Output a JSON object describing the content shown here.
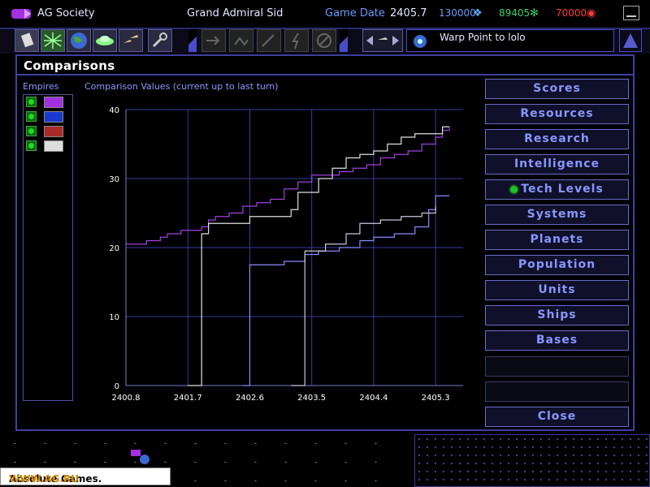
{
  "topbar": {
    "empire_name": "AG Society",
    "player": "Grand Admiral Sid",
    "game_date_label": "Game Date",
    "game_date": "2405.7",
    "resource_minerals": "130000",
    "resource_organics": "89405",
    "resource_radioactives": "70000"
  },
  "message": {
    "text": "Warp Point to lolo"
  },
  "window": {
    "title": "Comparisons",
    "empires_label": "Empires",
    "values_label": "Comparison Values (current up to last turn)"
  },
  "side_buttons": [
    {
      "label": "Scores"
    },
    {
      "label": "Resources"
    },
    {
      "label": "Research"
    },
    {
      "label": "Intelligence"
    },
    {
      "label": "Tech Levels"
    },
    {
      "label": "Systems"
    },
    {
      "label": "Planets"
    },
    {
      "label": "Population"
    },
    {
      "label": "Units"
    },
    {
      "label": "Ships"
    },
    {
      "label": "Bases"
    }
  ],
  "close_label": "Close",
  "watermark": {
    "text1": "Absolute Games.",
    "text2": "WWW.AG.RU"
  },
  "colors": {
    "accent": "#4040a0",
    "series_purple": "#a040e0",
    "series_white": "#e0e0e0",
    "series_blue": "#8a8aff",
    "series_gray": "#c8c8dc"
  },
  "chart_data": {
    "type": "line",
    "title": "",
    "xlabel": "",
    "ylabel": "",
    "xlim": [
      2400.8,
      2405.7
    ],
    "ylim": [
      0,
      40
    ],
    "x_ticks": [
      "2400.8",
      "2401.7",
      "2402.6",
      "2403.5",
      "2404.4",
      "2405.3"
    ],
    "y_ticks": [
      "0",
      "10",
      "20",
      "30",
      "40"
    ],
    "grid": true,
    "series": [
      {
        "color": "#a040e0",
        "x": [
          2400.8,
          2401.0,
          2401.1,
          2401.3,
          2401.4,
          2401.6,
          2401.9,
          2402.0,
          2402.1,
          2402.3,
          2402.5,
          2402.7,
          2402.9,
          2403.1,
          2403.3,
          2403.5,
          2403.7,
          2403.9,
          2404.1,
          2404.3,
          2404.5,
          2404.7,
          2404.9,
          2405.1,
          2405.3,
          2405.4,
          2405.5
        ],
        "y": [
          20.5,
          20.5,
          21.0,
          21.5,
          22.0,
          22.5,
          23.0,
          24.0,
          24.5,
          25.0,
          26.0,
          26.5,
          27.0,
          28.5,
          29.5,
          30.5,
          30.5,
          31.0,
          31.5,
          32.0,
          33.0,
          33.5,
          34.0,
          35.0,
          36.0,
          37.0,
          37.5
        ]
      },
      {
        "color": "#e0e0e0",
        "x": [
          2401.7,
          2401.9,
          2402.0,
          2402.3,
          2402.6,
          2403.0,
          2403.2,
          2403.3,
          2403.6,
          2403.8,
          2404.0,
          2404.2,
          2404.4,
          2404.6,
          2404.8,
          2405.0,
          2405.2,
          2405.4,
          2405.5
        ],
        "y": [
          0,
          22.0,
          23.5,
          23.5,
          24.5,
          24.5,
          25.5,
          28.0,
          30.0,
          31.5,
          33.0,
          33.5,
          34.0,
          35.0,
          36.0,
          36.5,
          36.5,
          37.5,
          37.5
        ]
      },
      {
        "color": "#8a8aff",
        "x": [
          2402.5,
          2402.6,
          2402.7,
          2403.1,
          2403.4,
          2403.6,
          2403.9,
          2404.2,
          2404.4,
          2404.7,
          2405.0,
          2405.2,
          2405.3,
          2405.5
        ],
        "y": [
          0,
          17.5,
          17.5,
          18.0,
          19.0,
          19.5,
          20.0,
          21.0,
          21.5,
          22.0,
          23.0,
          25.5,
          27.5,
          27.5
        ]
      },
      {
        "color": "#c8c8dc",
        "x": [
          2403.2,
          2403.4,
          2403.7,
          2404.0,
          2404.2,
          2404.5,
          2404.8,
          2405.1,
          2405.3
        ],
        "y": [
          0,
          19.5,
          20.5,
          22.0,
          23.5,
          24.0,
          24.5,
          25.0,
          26.0
        ]
      }
    ]
  }
}
